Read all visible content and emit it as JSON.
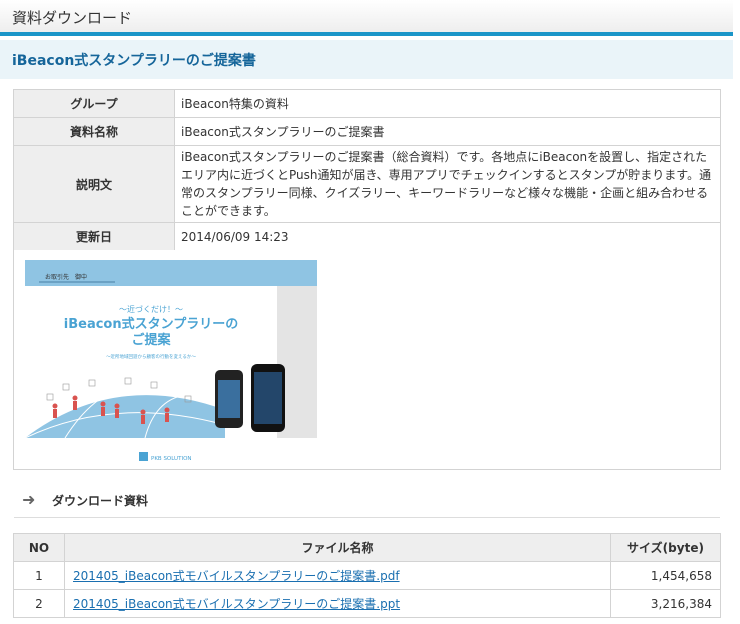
{
  "page": {
    "section_title": "資料ダウンロード",
    "doc_title": "iBeacon式スタンプラリーのご提案書"
  },
  "info": {
    "group_label": "グループ",
    "group_value": "iBeacon特集の資料",
    "name_label": "資料名称",
    "name_value": "iBeacon式スタンプラリーのご提案書",
    "desc_label": "説明文",
    "desc_value": "iBeacon式スタンプラリーのご提案書（総合資料）です。各地点にiBeaconを設置し、指定されたエリア内に近づくとPush通知が届き、専用アプリでチェックインするとスタンプが貯まります。通常のスタンプラリー同様、クイズラリー、キーワードラリーなど様々な機能・企画と組み合わせることができます。",
    "updated_label": "更新日",
    "updated_value": "2014/06/09 14:23"
  },
  "thumbnail": {
    "to_line": "お取引先　御中",
    "tagline": "〜近づくだけ！〜",
    "title_line1": "iBeacon式スタンプラリーの",
    "title_line2": "ご提案",
    "subtitle": "〜近所地域回遊から顧客の行動を変えるか〜",
    "company": "PKB SOLUTION",
    "colors": {
      "accent": "#4aa3d3",
      "globe": "#8fc4e3",
      "people": "#d9534f"
    }
  },
  "downloads": {
    "heading": "ダウンロード資料",
    "columns": {
      "no": "NO",
      "name": "ファイル名称",
      "size": "サイズ(byte)"
    },
    "rows": [
      {
        "no": "1",
        "name": "201405_iBeacon式モバイルスタンプラリーのご提案書.pdf",
        "size": "1,454,658"
      },
      {
        "no": "2",
        "name": "201405_iBeacon式モバイルスタンプラリーのご提案書.ppt",
        "size": "3,216,384"
      }
    ]
  }
}
